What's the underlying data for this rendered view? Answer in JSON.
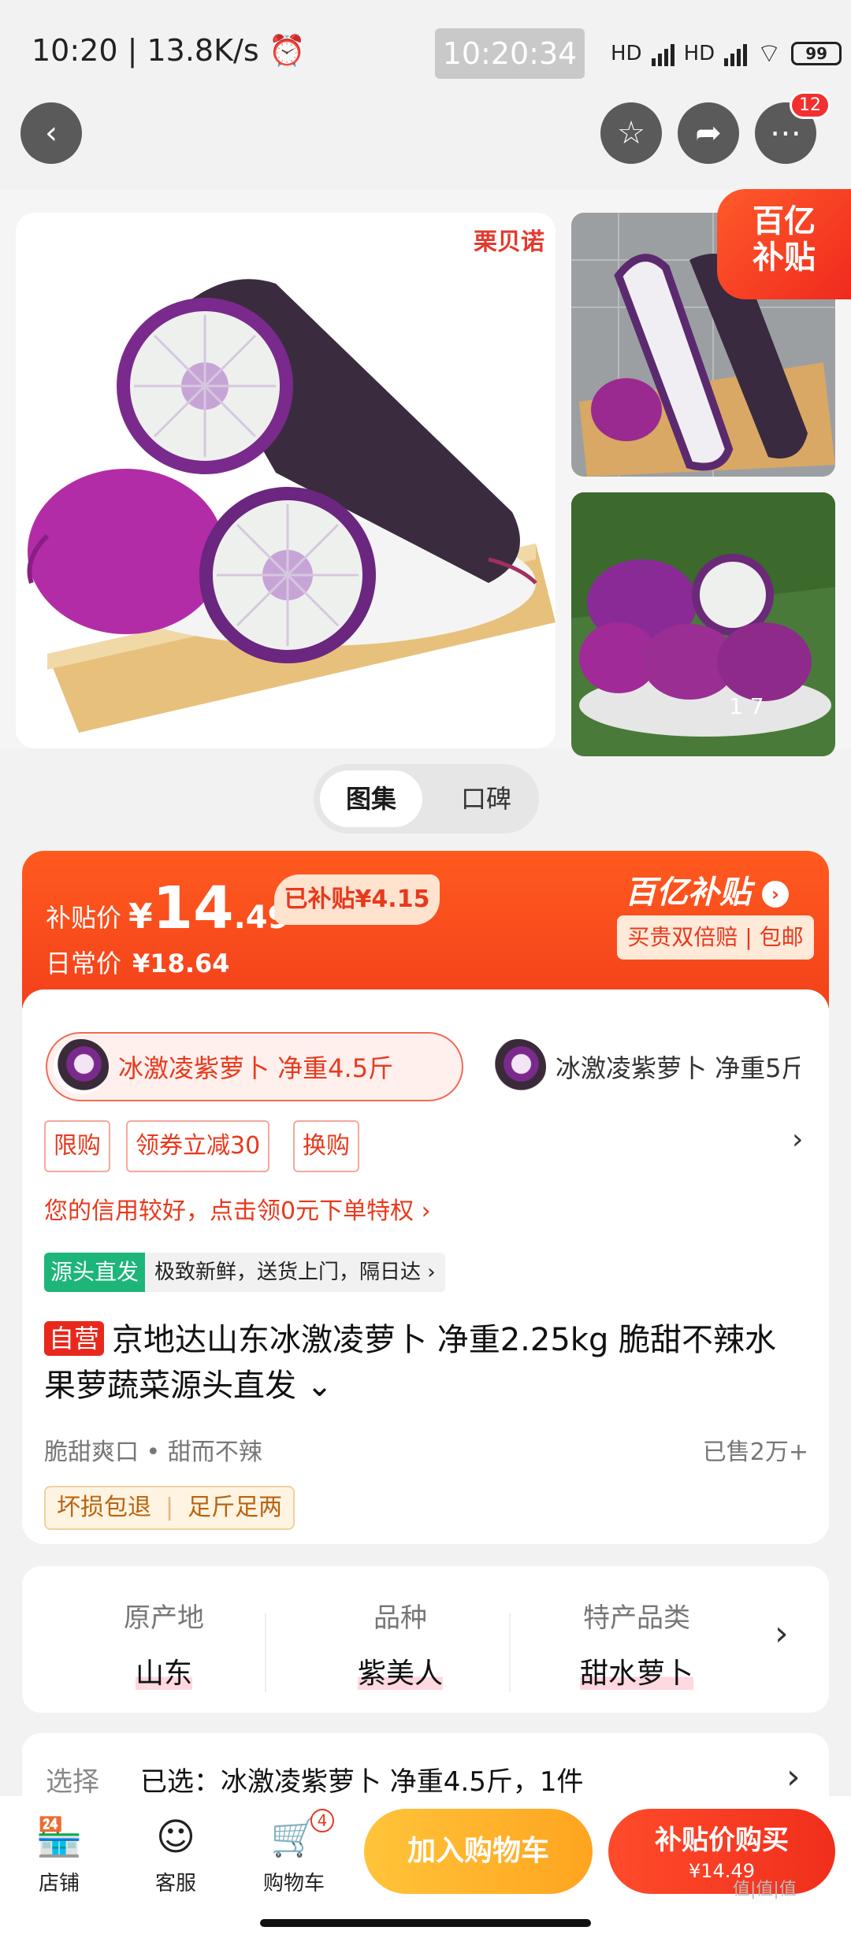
{
  "status_bar": {
    "time": "10:20",
    "speed": "| 13.8K/s",
    "clock": "10:20:34",
    "battery": "99",
    "hd1": "HD",
    "hd2": "HD"
  },
  "nav": {
    "more_badge": "12"
  },
  "gallery": {
    "brand_mark": "栗贝诺",
    "subsidy_tag_line1": "百亿",
    "subsidy_tag_line2": "补贴",
    "pager": "1 7",
    "tabs": [
      "图集",
      "口碑"
    ]
  },
  "price": {
    "label": "补贴价",
    "currency": "¥",
    "integer": "14",
    "decimal": ".49",
    "subsidy_amount": "已补贴¥4.15",
    "daily_label": "日常价",
    "daily_price": "¥18.64",
    "program": "百亿补贴",
    "guarantee": "买贵双倍赔 | 包邮"
  },
  "skus": [
    {
      "label": "冰激凌紫萝卜 净重4.5斤",
      "selected": true
    },
    {
      "label": "冰激凌紫萝卜 净重5斤",
      "selected": false
    }
  ],
  "promo_tags": [
    "限购",
    "领券立减30",
    "换购"
  ],
  "credit_text": "您的信用较好，点击领0元下单特权 ›",
  "origin_badge": {
    "tag": "源头直发",
    "text": "极致新鲜，送货上门，隔日达 ›"
  },
  "product": {
    "self_tag": "自营",
    "title": "京地达山东冰激凌萝卜 净重2.25kg  脆甜不辣水果萝蔬菜源头直发 ⌄",
    "features": "脆甜爽口  •  甜而不辣",
    "sold": "已售2万+",
    "services": [
      "坏损包退",
      "足斤足两"
    ]
  },
  "attributes": [
    {
      "key": "原产地",
      "value": "山东"
    },
    {
      "key": "品种",
      "value": "紫美人"
    },
    {
      "key": "特产品类",
      "value": "甜水萝卜"
    }
  ],
  "selection": {
    "label": "选择",
    "value": "已选：冰激凌紫萝卜 净重4.5斤，1件"
  },
  "bottom_bar": {
    "store": "店铺",
    "service": "客服",
    "cart": "购物车",
    "cart_count": "4",
    "add_to_cart": "加入购物车",
    "buy_line1": "补贴价购买",
    "buy_line2": "¥14.49"
  },
  "watermark": "值|值|值",
  "colors": {
    "accent": "#f3411a",
    "cart_button": "#ffa41f",
    "origin_green": "#1db57a"
  }
}
